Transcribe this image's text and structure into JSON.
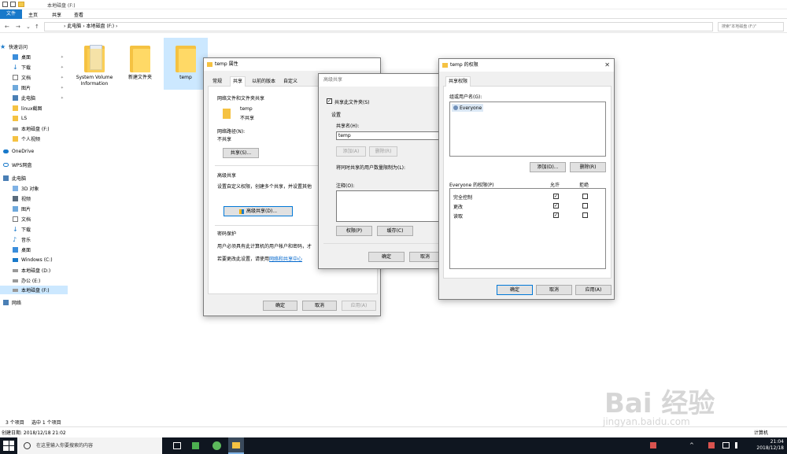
{
  "titlebar": {
    "title": "本地磁盘 (F:)"
  },
  "ribbon": {
    "file": "文件",
    "home": "主页",
    "share": "共享",
    "view": "查看"
  },
  "address": {
    "back": "←",
    "forward": "→",
    "down": "⌄",
    "up": "↑",
    "path": "›  此电脑  ›  本地磁盘 (F:)  ›",
    "search_placeholder": "搜索\"本地磁盘 (F:)\""
  },
  "nav": {
    "quick_access": "快速访问",
    "items": [
      "桌面",
      "下载",
      "文档",
      "图片",
      "此电脑",
      "linux截图",
      "LS",
      "本地磁盘 (F:)",
      "个人视频"
    ],
    "onedrive": "OneDrive",
    "wps": "WPS网盘",
    "this_pc": "此电脑",
    "pc_items": [
      "3D 对象",
      "视频",
      "图片",
      "文档",
      "下载",
      "音乐",
      "桌面",
      "Windows (C:)",
      "本地磁盘 (D:)",
      "办公 (E:)",
      "本地磁盘 (F:)"
    ],
    "network": "网络",
    "pin": "✦"
  },
  "content": {
    "items": [
      {
        "name": "System Volume Information"
      },
      {
        "name": "新建文件夹"
      },
      {
        "name": "temp"
      }
    ]
  },
  "status": {
    "count": "3 个项目",
    "selected": "选中 1 个项目",
    "created": "创建日期: 2018/12/18 21:02",
    "computer": "计算机"
  },
  "props": {
    "title": "temp 属性",
    "tabs": [
      "常规",
      "共享",
      "以前的版本",
      "自定义"
    ],
    "group1": "网络文件和文件夹共享",
    "folder_name": "temp",
    "folder_state": "不共享",
    "net_path_label": "网络路径(N):",
    "net_path_value": "不共享",
    "share_btn": "共享(S)...",
    "group2": "高级共享",
    "group2_desc": "设置自定义权限，创建多个共享，并设置其他",
    "adv_btn": "高级共享(D)...",
    "group3": "密码保护",
    "group3_desc": "用户必须具有此计算机的用户帐户和密码，才",
    "group3_link_pre": "若要更改此设置，请使用",
    "group3_link": "网络和共享中心",
    "ok": "确定",
    "cancel": "取消",
    "apply": "应用(A)"
  },
  "adv": {
    "title": "高级共享",
    "share_this": "共享此文件夹(S)",
    "settings": "设置",
    "share_name_label": "共享名(H):",
    "share_name": "temp",
    "add": "添加(A)",
    "remove": "删除(R)",
    "limit": "将同时共享的用户数量限制为(L):",
    "comment": "注释(O):",
    "perm": "权限(P)",
    "cache": "缓存(C)",
    "ok": "确定",
    "cancel": "取消"
  },
  "perms": {
    "title": "temp 的权限",
    "tab": "共享权限",
    "group_label": "组或用户名(G):",
    "user": "Everyone",
    "add": "添加(D)...",
    "remove": "删除(R)",
    "perm_label": "Everyone 的权限(P)",
    "allow": "允许",
    "deny": "拒绝",
    "rows": [
      {
        "name": "完全控制",
        "allow": true,
        "deny": false
      },
      {
        "name": "更改",
        "allow": true,
        "deny": false
      },
      {
        "name": "读取",
        "allow": true,
        "deny": false
      }
    ],
    "ok": "确定",
    "cancel": "取消",
    "apply": "应用(A)"
  },
  "taskbar": {
    "search": "在这里输入你要搜索的内容",
    "time": "21:04",
    "date": "2018/12/18"
  },
  "watermark": {
    "brand": "Bai 经验",
    "url": "jingyan.baidu.com"
  }
}
